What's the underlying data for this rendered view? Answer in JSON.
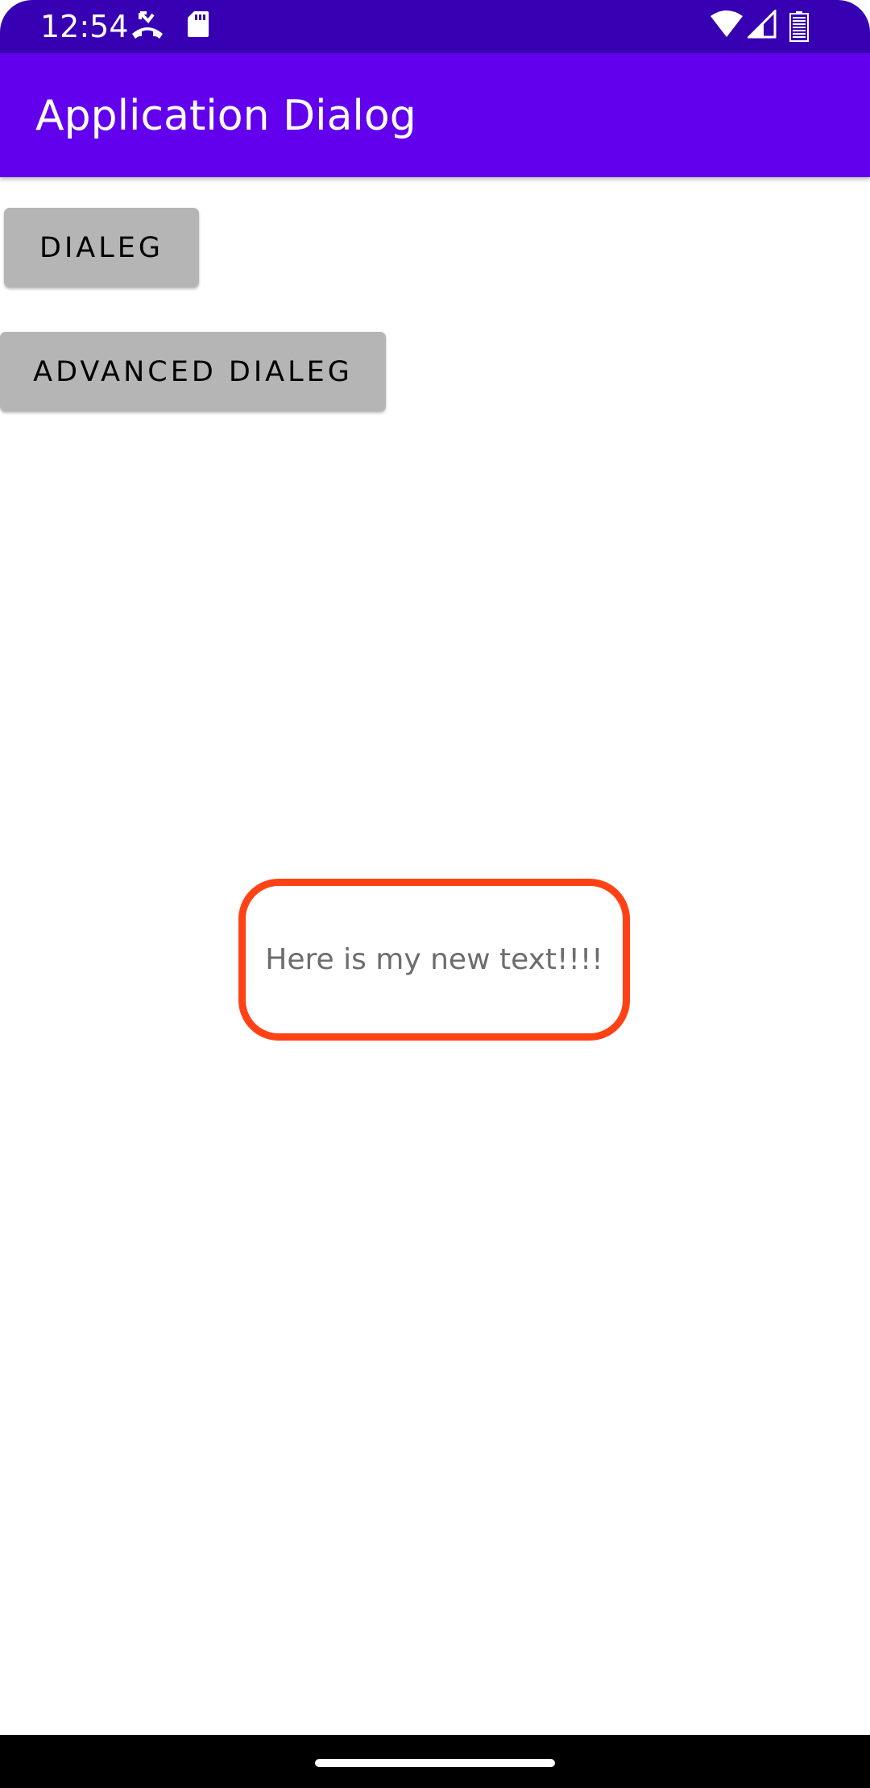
{
  "status_bar": {
    "time": "12:54",
    "icons": [
      "missed-call-icon",
      "sd-card-icon",
      "wifi-icon",
      "signal-icon",
      "battery-icon"
    ]
  },
  "app_bar": {
    "title": "Application Dialog",
    "color": "#6200ee"
  },
  "buttons": {
    "dialog_label": "DIALEG",
    "advanced_dialog_label": "ADVANCED DIALEG"
  },
  "toast": {
    "text": "Here is my new text!!!!",
    "border_color": "#ff4216"
  },
  "colors": {
    "status_bar": "#3700b3",
    "button_bg": "#b5b5b5",
    "nav_bar": "#000000"
  }
}
